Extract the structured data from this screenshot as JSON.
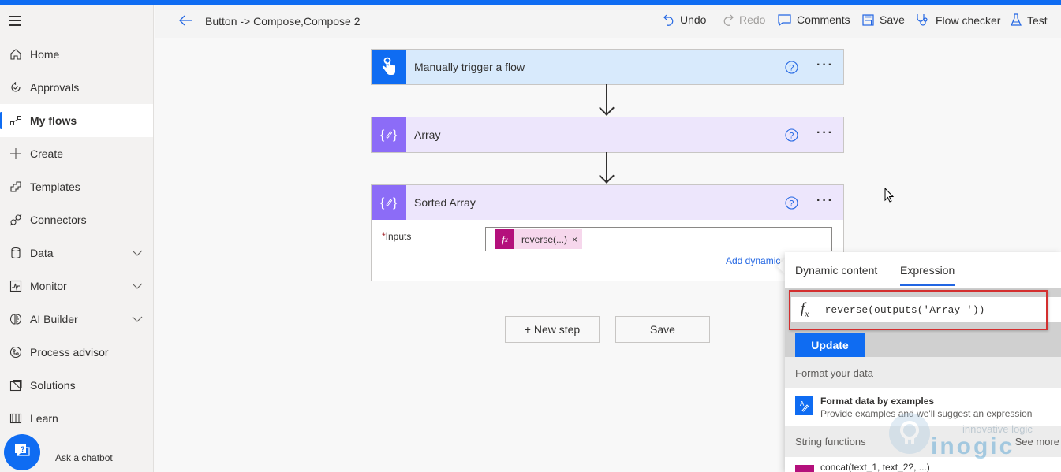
{
  "sidebar": {
    "menu_icon": "hamburger-icon",
    "items": [
      {
        "label": "Home",
        "icon": "home-icon"
      },
      {
        "label": "Approvals",
        "icon": "approvals-icon"
      },
      {
        "label": "My flows",
        "icon": "flows-icon",
        "active": true
      },
      {
        "label": "Create",
        "icon": "plus-icon"
      },
      {
        "label": "Templates",
        "icon": "templates-icon"
      },
      {
        "label": "Connectors",
        "icon": "connectors-icon"
      },
      {
        "label": "Data",
        "icon": "database-icon",
        "expandable": true
      },
      {
        "label": "Monitor",
        "icon": "monitor-icon",
        "expandable": true
      },
      {
        "label": "AI Builder",
        "icon": "ai-builder-icon",
        "expandable": true
      },
      {
        "label": "Process advisor",
        "icon": "process-advisor-icon"
      },
      {
        "label": "Solutions",
        "icon": "solutions-icon"
      },
      {
        "label": "Learn",
        "icon": "book-icon"
      }
    ],
    "chatbot_label": "Ask a chatbot"
  },
  "header": {
    "breadcrumb": "Button -> Compose,Compose 2",
    "toolbar": {
      "undo": "Undo",
      "redo": "Redo",
      "comments": "Comments",
      "save": "Save",
      "flow_checker": "Flow checker",
      "test": "Test"
    }
  },
  "flow": {
    "steps": [
      {
        "title": "Manually trigger a flow",
        "icon": "touch-trigger-icon",
        "color": "#0f6cf2",
        "bg": "#d8eafc"
      },
      {
        "title": "Array",
        "icon": "compose-icon",
        "color": "#8c6cf7",
        "bg": "#ede6fc"
      },
      {
        "title": "Sorted Array",
        "icon": "compose-icon",
        "color": "#8c6cf7",
        "bg": "#ede6fc"
      }
    ],
    "inputs_label": "Inputs",
    "required_mark": "*",
    "token_text": "reverse(...)",
    "token_remove": "×",
    "add_dynamic_link": "Add dynamic content",
    "new_step": "+ New step",
    "save": "Save"
  },
  "expression_panel": {
    "tabs": [
      "Dynamic content",
      "Expression"
    ],
    "active_tab": "Expression",
    "fx_symbol": "fx",
    "expression_value": "reverse(outputs('Array_'))",
    "update_button": "Update",
    "sections": [
      {
        "title": "Format your data"
      },
      {
        "title": "String functions",
        "see_more": "See more"
      }
    ],
    "format_item": {
      "title": "Format data by examples",
      "subtitle": "Provide examples and we'll suggest an expression"
    },
    "function_item": "concat(text_1, text_2?, ...)"
  },
  "watermark": {
    "tagline": "innovative logic",
    "brand": "inogic"
  }
}
